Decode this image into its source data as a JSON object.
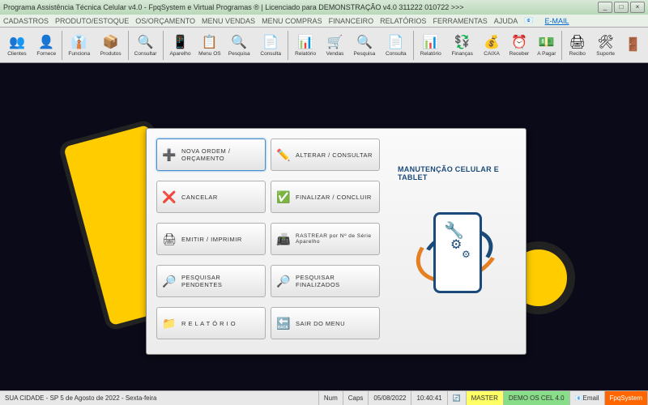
{
  "titlebar": {
    "text": "Programa Assistência Técnica Celular v4.0 - FpqSystem e Virtual Programas ® | Licenciado para  DEMONSTRAÇÃO v4.0 311222 010722 >>>"
  },
  "menubar": {
    "items": [
      "CADASTROS",
      "PRODUTO/ESTOQUE",
      "OS/ORÇAMENTO",
      "MENU VENDAS",
      "MENU COMPRAS",
      "FINANCEIRO",
      "RELATÓRIOS",
      "FERRAMENTAS",
      "AJUDA"
    ],
    "email": "E-MAIL"
  },
  "toolbar": {
    "items": [
      {
        "label": "Clientes",
        "icon": "👥"
      },
      {
        "label": "Fornece",
        "icon": "👤"
      },
      {
        "label": "Funciona",
        "icon": "👔"
      },
      {
        "label": "Produtos",
        "icon": "📦"
      },
      {
        "label": "Consultar",
        "icon": "🔍"
      },
      {
        "label": "Aparelho",
        "icon": "📱"
      },
      {
        "label": "Menu OS",
        "icon": "📋"
      },
      {
        "label": "Pesquisa",
        "icon": "🔍"
      },
      {
        "label": "Consulta",
        "icon": "📄"
      },
      {
        "label": "Relatório",
        "icon": "📊"
      },
      {
        "label": "Vendas",
        "icon": "🛒"
      },
      {
        "label": "Pesquisa",
        "icon": "🔍"
      },
      {
        "label": "Consulta",
        "icon": "📄"
      },
      {
        "label": "Relatório",
        "icon": "📊"
      },
      {
        "label": "Finanças",
        "icon": "💱"
      },
      {
        "label": "CAIXA",
        "icon": "💰"
      },
      {
        "label": "Receber",
        "icon": "⏰"
      },
      {
        "label": "A Pagar",
        "icon": "💵"
      },
      {
        "label": "Recibo",
        "icon": "🖨"
      },
      {
        "label": "Suporte",
        "icon": "🛠"
      },
      {
        "label": "",
        "icon": "🚪"
      }
    ]
  },
  "dialog": {
    "buttons": [
      {
        "label": "NOVA ORDEM / ORÇAMENTO",
        "icon": "➕",
        "sel": true
      },
      {
        "label": "ALTERAR  /  CONSULTAR",
        "icon": "✏️"
      },
      {
        "label": "CANCELAR",
        "icon": "❌"
      },
      {
        "label": "FINALIZAR  /  CONCLUIR",
        "icon": "✅"
      },
      {
        "label": "EMITIR  /  IMPRIMIR",
        "icon": "🖨"
      },
      {
        "label": "RASTREAR por Nº de Série Aparelho",
        "icon": "📠",
        "small": true
      },
      {
        "label": "PESQUISAR PENDENTES",
        "icon": "🔎"
      },
      {
        "label": "PESQUISAR FINALIZADOS",
        "icon": "🔎"
      },
      {
        "label": "R E L A T Ó R I O",
        "icon": "📁"
      },
      {
        "label": "SAIR DO MENU",
        "icon": "🔙"
      }
    ],
    "logo_title": "MANUTENÇÃO CELULAR E TABLET"
  },
  "statusbar": {
    "location": "SUA CIDADE - SP  5 de Agosto de 2022 - Sexta-feira",
    "num": "Num",
    "caps": "Caps",
    "date": "05/08/2022",
    "time": "10:40:41",
    "user": "MASTER",
    "db": "DEMO OS CEL 4.0",
    "mail": "Email",
    "brand": "FpqSystem"
  }
}
